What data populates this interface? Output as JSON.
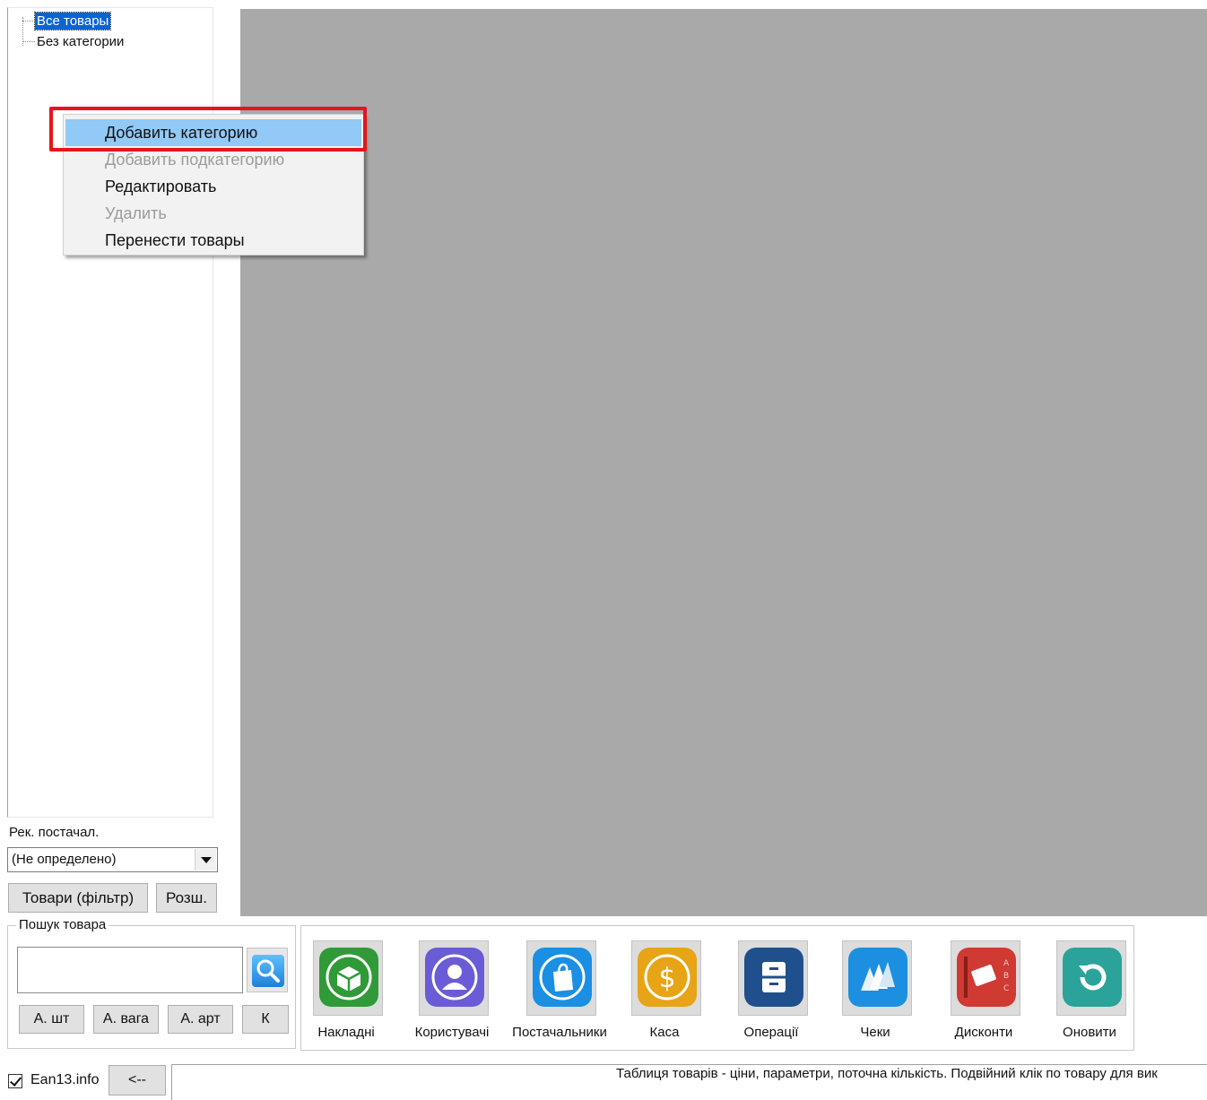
{
  "tree": {
    "items": [
      {
        "label": "Все товары",
        "selected": true
      },
      {
        "label": "Без категории",
        "selected": false
      }
    ]
  },
  "context_menu": {
    "items": [
      {
        "label": "Добавить категорию",
        "enabled": true,
        "highlighted": true
      },
      {
        "label": "Добавить подкатегорию",
        "enabled": false
      },
      {
        "label": "Редактировать",
        "enabled": true
      },
      {
        "label": "Удалить",
        "enabled": false
      },
      {
        "label": "Перенести товары",
        "enabled": true
      }
    ],
    "annotation_color": "#e8141b"
  },
  "supplier": {
    "label": "Рек. постачал.",
    "selected": "(Не определено)"
  },
  "filter_buttons": {
    "goods_filter": "Товари (фільтр)",
    "extended": "Розш."
  },
  "search": {
    "group_title": "Пошук товара",
    "value": "",
    "buttons": [
      "А. шт",
      "А. вага",
      "А. арт",
      "К"
    ]
  },
  "toolbar": {
    "items": [
      {
        "label": "Накладні",
        "icon": "invoices-box-icon",
        "color": "#2f9a37"
      },
      {
        "label": "Користувачі",
        "icon": "user-icon",
        "color": "#6a5bd6"
      },
      {
        "label": "Постачальники",
        "icon": "shopping-bag-icon",
        "color": "#1a8fe3"
      },
      {
        "label": "Каса",
        "icon": "dollar-coin-icon",
        "color": "#e7a416"
      },
      {
        "label": "Операції",
        "icon": "file-cabinet-icon",
        "color": "#1f4f8c"
      },
      {
        "label": "Чеки",
        "icon": "receipts-icon",
        "color": "#1d8fe0"
      },
      {
        "label": "Дисконти",
        "icon": "discount-book-icon",
        "color": "#cf3a32"
      },
      {
        "label": "Оновити",
        "icon": "refresh-icon",
        "color": "#2ba39a"
      }
    ]
  },
  "status_bar": {
    "checkbox_label": "Ean13.info",
    "checkbox_checked": true,
    "back_button": "<--",
    "hint": "Таблиця товарів - ціни, параметри, поточна кількість. Подвійний клік по товару для вик"
  }
}
